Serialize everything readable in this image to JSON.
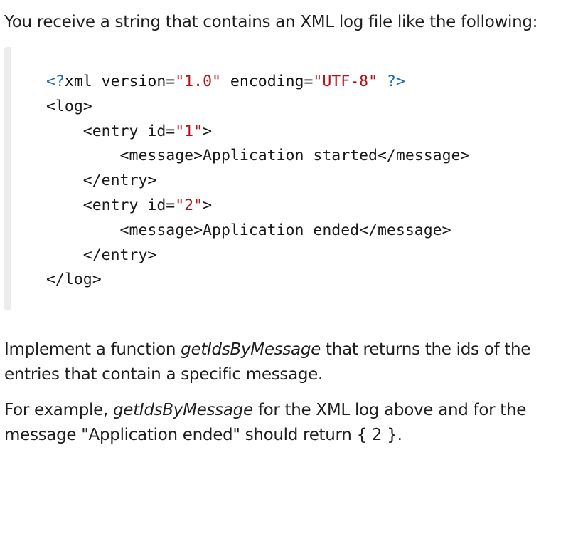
{
  "intro": {
    "text": "You receive a string that contains an XML log file like the following:"
  },
  "code": {
    "line1": {
      "pi_open": "<?",
      "xml_kw": "xml version=",
      "version": "\"1.0\"",
      "enc_kw": " encoding=",
      "encoding": "\"UTF-8\"",
      "pi_close": " ?>"
    },
    "line2": "<log>",
    "line3": {
      "tag": "    <entry id=",
      "id": "\"1\"",
      "close": ">"
    },
    "line4": "        <message>Application started</message>",
    "line5": "    </entry>",
    "line6": {
      "tag": "    <entry id=",
      "id": "\"2\"",
      "close": ">"
    },
    "line7": "        <message>Application ended</message>",
    "line8": "    </entry>",
    "line9": "</log>"
  },
  "task": {
    "before": "Implement a function ",
    "fn": "getIdsByMessage",
    "after": " that returns the ids of the entries that contain a specific message."
  },
  "example": {
    "before": "For example, ",
    "fn": "getIdsByMessage",
    "after": " for the XML log above and for the message \"Application ended\" should return { 2 }."
  },
  "colors": {
    "processing_instruction": "#1f6fa8",
    "string_literal": "#b3121b",
    "block_border": "#ececec"
  }
}
